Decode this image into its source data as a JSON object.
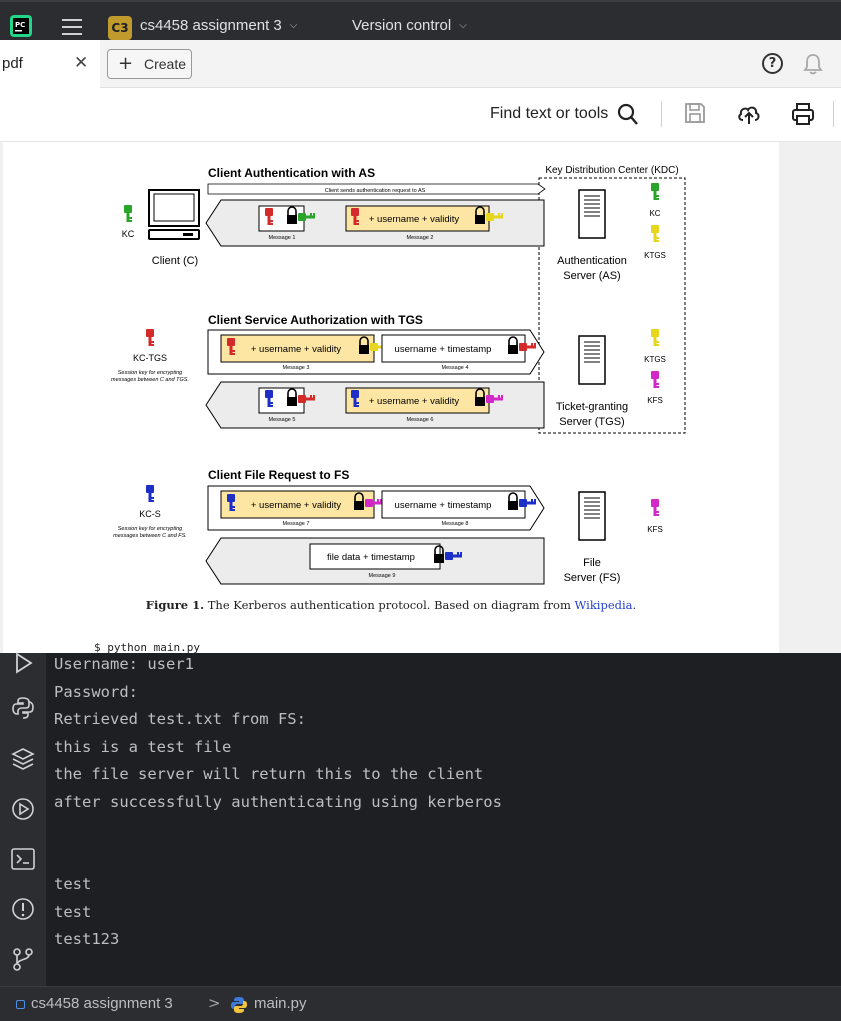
{
  "topbar": {
    "project_badge": "C3",
    "project_name": "cs4458 assignment 3",
    "version_control": "Version control"
  },
  "pdf_toolbar": {
    "tab_label": "pdf",
    "create_label": "Create",
    "find_label": "Find text or tools"
  },
  "diagram": {
    "kdc_title": "Key Distribution Center (KDC)",
    "section_as": "Client Authentication with AS",
    "section_tgs": "Client Service Authorization with TGS",
    "section_fs": "Client File Request to FS",
    "client_request_note": "Client sends authentication request to AS",
    "client_label": "Client (C)",
    "kc_label": "KC",
    "kc_tgs_label": "KC-TGS",
    "kc_tgs_desc_1": "Session key for encrypting",
    "kc_tgs_desc_2": "messages between C and TGS.",
    "kc_s_label": "KC-S",
    "kc_s_desc_1": "Session key for encrypting",
    "kc_s_desc_2": "messages between C and FS.",
    "as_label_1": "Authentication",
    "as_label_2": "Server (AS)",
    "tgs_label_1": "Ticket-granting",
    "tgs_label_2": "Server (TGS)",
    "fs_label_1": "File",
    "fs_label_2": "Server (FS)",
    "kdc_kc": "KC",
    "kdc_ktgs": "KTGS",
    "tgs_ktgs": "KTGS",
    "tgs_kfs": "KFS",
    "fs_kfs": "KFS",
    "msg_username_validity": "+ username + validity",
    "msg_username_timestamp": "username + timestamp",
    "msg_file_data": "file data + timestamp",
    "m1": "Message 1",
    "m2": "Message 2",
    "m3": "Message 3",
    "m4": "Message 4",
    "m5": "Message 5",
    "m6": "Message 6",
    "m7": "Message 7",
    "m8": "Message 8",
    "m9": "Message 9"
  },
  "caption": {
    "label": "Figure 1.",
    "text": " The Kerberos authentication protocol. Based on diagram from ",
    "link": "Wikipedia",
    "end": "."
  },
  "pdf_cmdline": "$ python main.py",
  "console_lines": [
    "Username: user1",
    "Password:",
    "Retrieved test.txt from FS:",
    "this is a test file",
    "the file server will return this to the client",
    "after successfully authenticating using kerberos",
    "",
    "",
    "test",
    "test",
    "test123"
  ],
  "statusbar": {
    "project": "cs4458 assignment 3",
    "separator": ">",
    "file": "main.py"
  },
  "colors": {
    "key_green": "#2aa52a",
    "key_red": "#d42a2a",
    "key_yellow": "#e6d61e",
    "key_blue": "#1e2fc8",
    "key_magenta": "#d228c8",
    "msg_fill": "#fde6a3",
    "badge": "#c09a2c"
  }
}
